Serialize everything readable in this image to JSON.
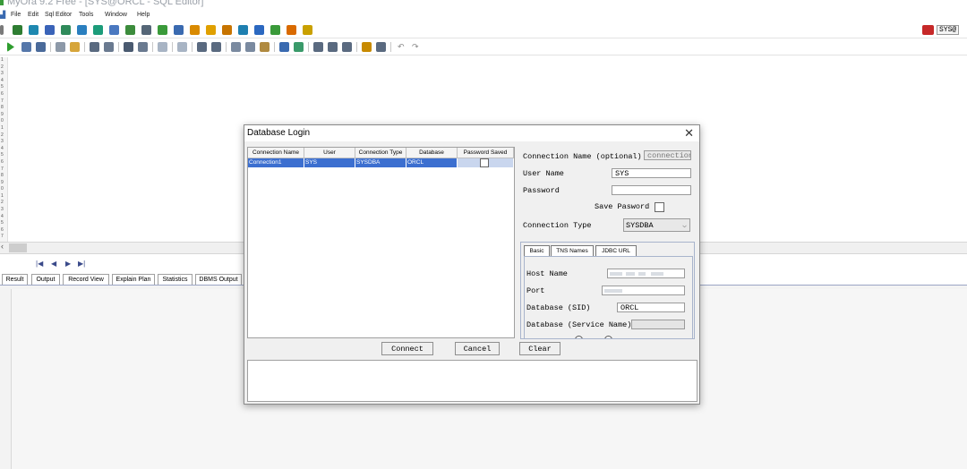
{
  "app": {
    "title": "MyOra 9.2 Free - [SYS@ORCL - SQL Editor]"
  },
  "menu": [
    "File",
    "Edit",
    "Sql Editor",
    "Tools",
    "Window",
    "Help"
  ],
  "toolbar": {
    "top_right_label": "SYS@"
  },
  "editor": {
    "line_numbers": [
      "1",
      "2",
      "3",
      "4",
      "5",
      "6",
      "7",
      "8",
      "9",
      "0",
      "1",
      "2",
      "3",
      "4",
      "5",
      "6",
      "7",
      "8",
      "9",
      "0",
      "1",
      "2",
      "3",
      "4",
      "5",
      "6",
      "7"
    ]
  },
  "result_tabs": [
    "Result",
    "Output",
    "Record View",
    "Explain Plan",
    "Statistics",
    "DBMS Output"
  ],
  "nav": {
    "first": "|◀",
    "prev": "◀",
    "next": "▶",
    "last": "▶|"
  },
  "dialog": {
    "title": "Database Login",
    "close": "✕",
    "table": {
      "columns": [
        "Connection Name",
        "User",
        "Connection Type",
        "Database",
        "Password Saved"
      ],
      "rows": [
        {
          "name": "Connection1",
          "user": "SYS",
          "type": "SYSDBA",
          "database": "ORCL",
          "password_saved": false
        }
      ]
    },
    "form": {
      "conn_name_label": "Connection Name (optional)",
      "conn_name_value": "connection1",
      "user_label": "User Name",
      "user_value": "SYS",
      "password_label": "Password",
      "password_value": "",
      "save_label": "Save Pasword",
      "conn_type_label": "Connection Type",
      "conn_type_value": "SYSDBA"
    },
    "sub_tabs": [
      "Basic",
      "TNS Names",
      "JDBC URL"
    ],
    "basic": {
      "host_label": "Host Name",
      "port_label": "Port",
      "sid_label": "Database (SID)",
      "sid_value": "ORCL",
      "service_label": "Database (Service Name)"
    },
    "buttons": {
      "connect": "Connect",
      "cancel": "Cancel",
      "clear": "Clear"
    }
  },
  "colors": {
    "selection": "#3c6fd0",
    "accent": "#3a9a3a"
  }
}
